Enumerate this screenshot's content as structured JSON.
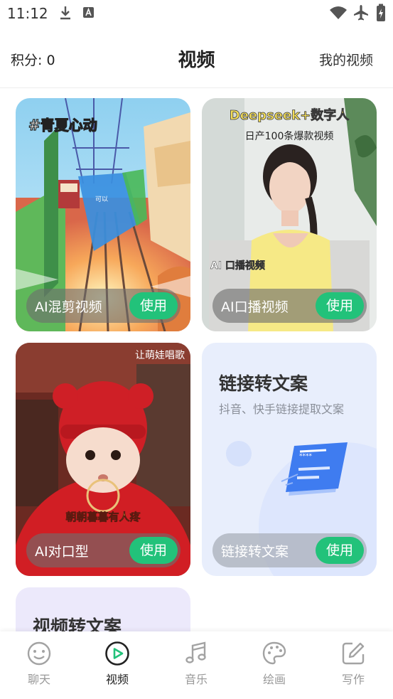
{
  "status": {
    "time": "11:12"
  },
  "header": {
    "points": "积分: 0",
    "title": "视频",
    "my_videos": "我的视频"
  },
  "cards": [
    {
      "label": "AI混剪视频",
      "button": "使用",
      "overlay_text": "#青夏心动",
      "sign_text": "可以"
    },
    {
      "label": "AI口播视频",
      "button": "使用",
      "overlay_title": "Deepseek+数字人",
      "overlay_sub": "日产100条爆款视频",
      "overlay_caption": "AI 口播视频"
    },
    {
      "label": "AI对口型",
      "button": "使用",
      "overlay_text": "让萌娃唱歌",
      "overlay_caption": "朝朝暮暮有人疼"
    },
    {
      "label": "链接转文案",
      "button": "使用",
      "heading": "链接转文案",
      "subtitle": "抖音、快手链接提取文案"
    }
  ],
  "video_to_text": {
    "heading": "视频转文案"
  },
  "nav": [
    {
      "label": "聊天",
      "icon": "chat-smile-icon"
    },
    {
      "label": "视频",
      "icon": "video-play-icon",
      "active": true
    },
    {
      "label": "音乐",
      "icon": "music-note-icon"
    },
    {
      "label": "绘画",
      "icon": "palette-icon"
    },
    {
      "label": "写作",
      "icon": "edit-pen-icon"
    }
  ],
  "colors": {
    "accent": "#22c27a",
    "link_card_bg": "#e8eefc",
    "video_card_bg": "#ece9fb"
  }
}
